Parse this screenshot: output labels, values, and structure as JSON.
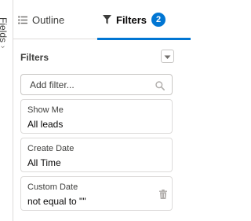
{
  "rail": {
    "label": "Fields",
    "chevron": "›"
  },
  "tabs": [
    {
      "label": "Outline",
      "icon": "list-icon",
      "active": false
    },
    {
      "label": "Filters",
      "icon": "filter-icon",
      "active": true,
      "badge": "2"
    }
  ],
  "filters_panel": {
    "title": "Filters",
    "menu_icon": "chevron-down-icon",
    "search": {
      "placeholder": "Add filter...",
      "value": "",
      "icon": "search-icon"
    },
    "items": [
      {
        "label": "Show Me",
        "value": "All leads",
        "removable": false
      },
      {
        "label": "Create Date",
        "value": "All Time",
        "removable": false
      },
      {
        "label": "Custom Date",
        "value": "not equal to \"\"",
        "removable": true,
        "icon": "trash-icon"
      }
    ]
  },
  "colors": {
    "accent": "#0176d3",
    "border": "#dddbda",
    "text": "#080707",
    "muted": "#3e3e3c"
  }
}
